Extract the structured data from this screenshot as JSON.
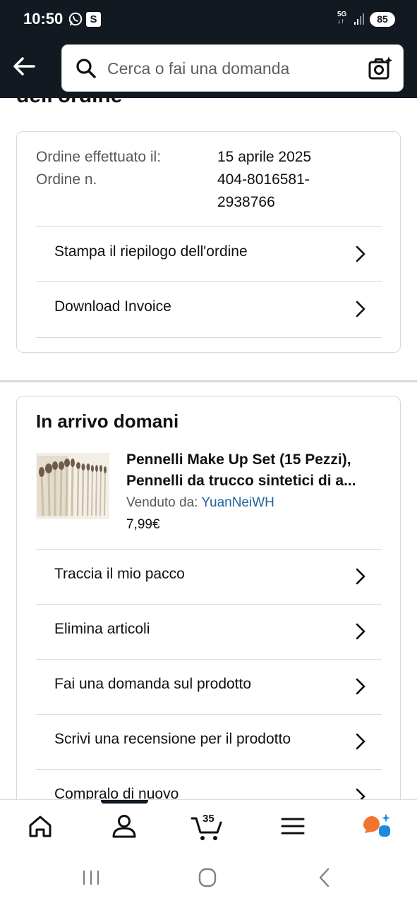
{
  "status_bar": {
    "time": "10:50",
    "app_badge": "S",
    "network": "5G",
    "battery": "85"
  },
  "header": {
    "search_placeholder": "Cerca o fai una domanda"
  },
  "page": {
    "title_peek": "dell'ordine"
  },
  "order_summary": {
    "date_label": "Ordine effettuato il:",
    "date_value": "15 aprile 2025",
    "number_label": "Ordine n.",
    "number_value_line1": "404-8016581-",
    "number_value_line2": "2938766",
    "actions": [
      {
        "label": "Stampa il riepilogo dell'ordine"
      },
      {
        "label": "Download Invoice"
      }
    ]
  },
  "shipment": {
    "title": "In arrivo domani",
    "product": {
      "title_line1": "Pennelli Make Up Set (15 Pezzi),",
      "title_line2": "Pennelli da trucco sintetici di a...",
      "seller_label": "Venduto da: ",
      "seller_name": "YuanNeiWH",
      "price": "7,99€"
    },
    "actions": [
      {
        "label": "Traccia il mio pacco"
      },
      {
        "label": "Elimina articoli"
      },
      {
        "label": "Fai una domanda sul prodotto"
      },
      {
        "label": "Scrivi una recensione per il prodotto"
      },
      {
        "label": "Compralo di nuovo"
      }
    ]
  },
  "bottom_nav": {
    "cart_count": "35",
    "items": [
      "home-icon",
      "account-icon",
      "cart-icon",
      "menu-icon",
      "rufus-assistant-icon"
    ]
  },
  "colors": {
    "header_bg": "#131921",
    "link": "#2162a1",
    "divider": "#d5d9d9",
    "assistant_orange": "#f3752d",
    "assistant_blue": "#1a8ce0"
  }
}
